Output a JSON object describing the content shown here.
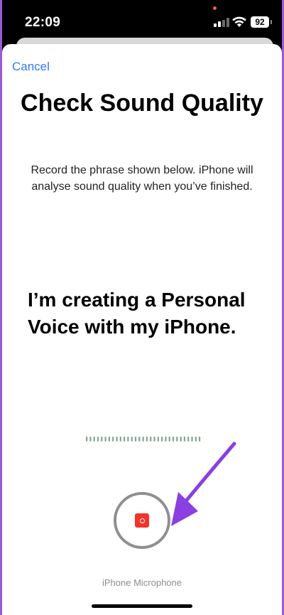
{
  "status_bar": {
    "time": "22:09",
    "battery": "92"
  },
  "header": {
    "cancel_label": "Cancel"
  },
  "main": {
    "title": "Check Sound Quality",
    "subtitle": "Record the phrase shown below. iPhone will analyse sound quality when you’ve finished.",
    "phrase": "I’m creating a Personal Voice with my iPhone.",
    "input_source": "iPhone Microphone"
  },
  "icons": {
    "record": "record-stop-icon",
    "annotation": "arrow-icon",
    "waveform": "waveform-icon"
  },
  "colors": {
    "accent": "#2f7df6",
    "record": "#f2332b",
    "annotation_arrow": "#8b3fe0",
    "waveform": "#7fa88a"
  }
}
